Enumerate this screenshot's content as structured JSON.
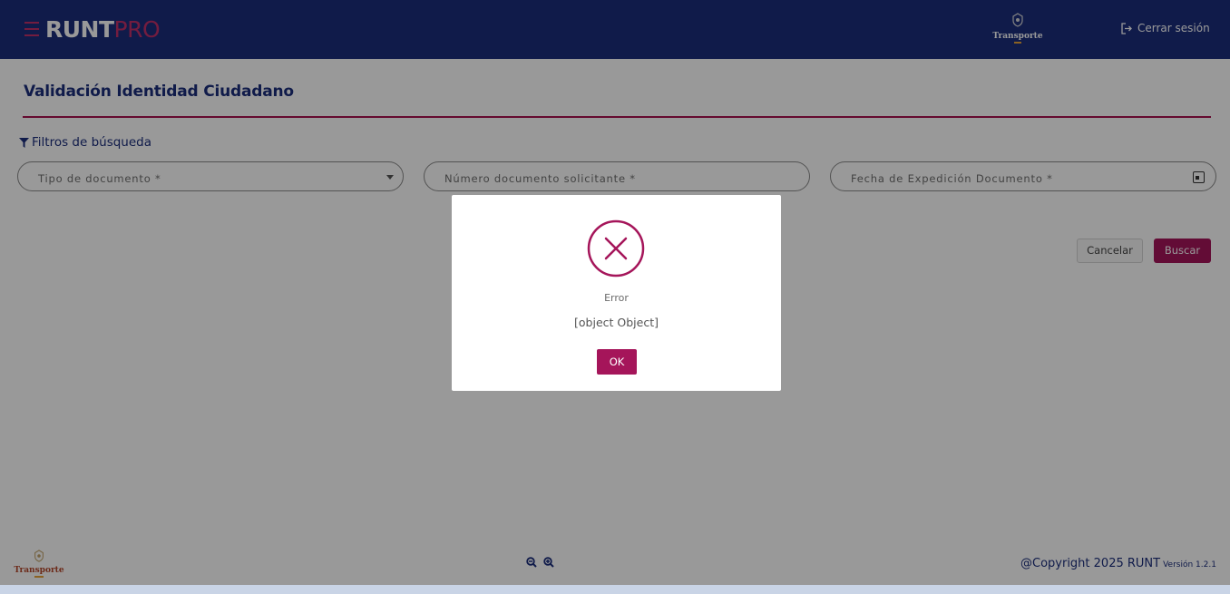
{
  "header": {
    "logo_primary": "RUNT",
    "logo_secondary": "PRO",
    "ministry_label": "Transporte",
    "logout_label": "Cerrar sesión",
    "icons": [
      "menu-icon",
      "ministry-emblem-icon",
      "logout-icon"
    ]
  },
  "page": {
    "title": "Validación Identidad Ciudadano",
    "filters_label": "Filtros de búsqueda"
  },
  "form": {
    "doc_type_placeholder": "Tipo de documento *",
    "doc_number_placeholder": "Número documento solicitante *",
    "issue_date_placeholder": "Fecha de Expedición Documento *",
    "cancel_label": "Cancelar",
    "search_label": "Buscar"
  },
  "footer": {
    "ministry_label": "Transporte",
    "copyright": "@Copyright 2025 RUNT",
    "version": "Versión 1.2.1",
    "icons": [
      "zoom-out-icon",
      "zoom-in-icon"
    ]
  },
  "dialog": {
    "title": "Error",
    "message": "[object Object]",
    "ok_label": "OK",
    "icon": "error-x-circle-icon"
  },
  "colors": {
    "header_bg": "#1c2e7c",
    "accent": "#a5155a",
    "divider": "#a8124f",
    "overlay": "rgba(0,0,0,0.4)"
  }
}
